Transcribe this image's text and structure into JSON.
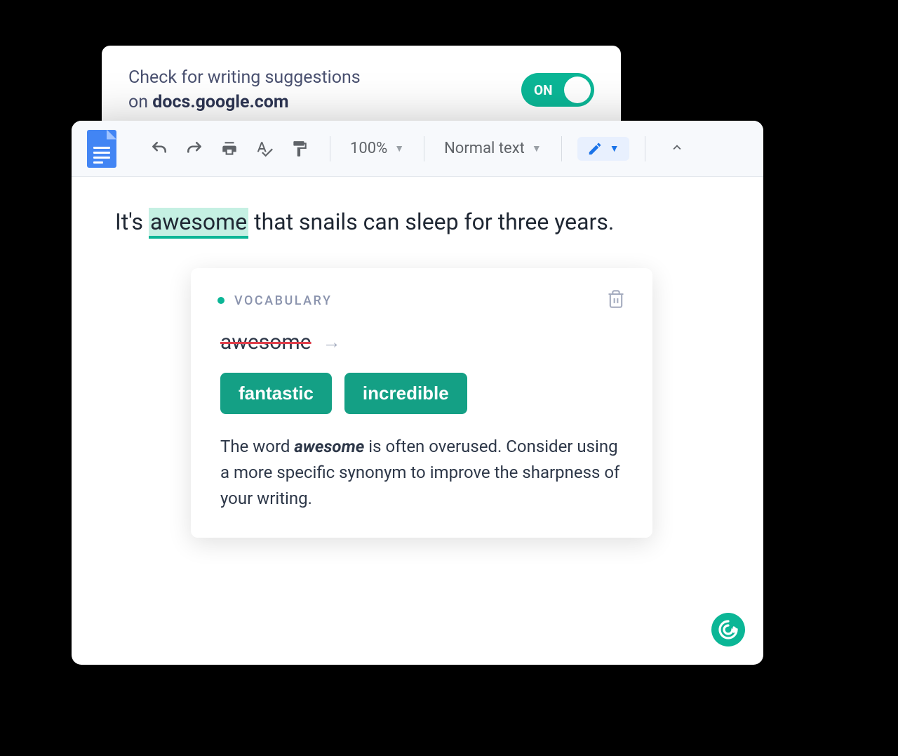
{
  "settings": {
    "prompt_line1": "Check for writing suggestions",
    "prompt_line2_prefix": "on ",
    "prompt_domain": "docs.google.com",
    "toggle_label": "ON",
    "toggle_state": true
  },
  "toolbar": {
    "zoom_level": "100%",
    "style_name": "Normal text"
  },
  "document": {
    "text_before": "It's ",
    "highlighted_word": "awesome",
    "text_after": " that snails can sleep for three years."
  },
  "suggestion": {
    "category": "VOCABULARY",
    "original_word": "awesome",
    "replacements": [
      "fantastic",
      "incredible"
    ],
    "description_prefix": "The word ",
    "description_word": "awesome",
    "description_suffix": " is often overused. Consider using a more specific synonym to improve the sharpness of your writing."
  },
  "colors": {
    "accent": "#0bb696",
    "google_blue": "#4285f4"
  }
}
